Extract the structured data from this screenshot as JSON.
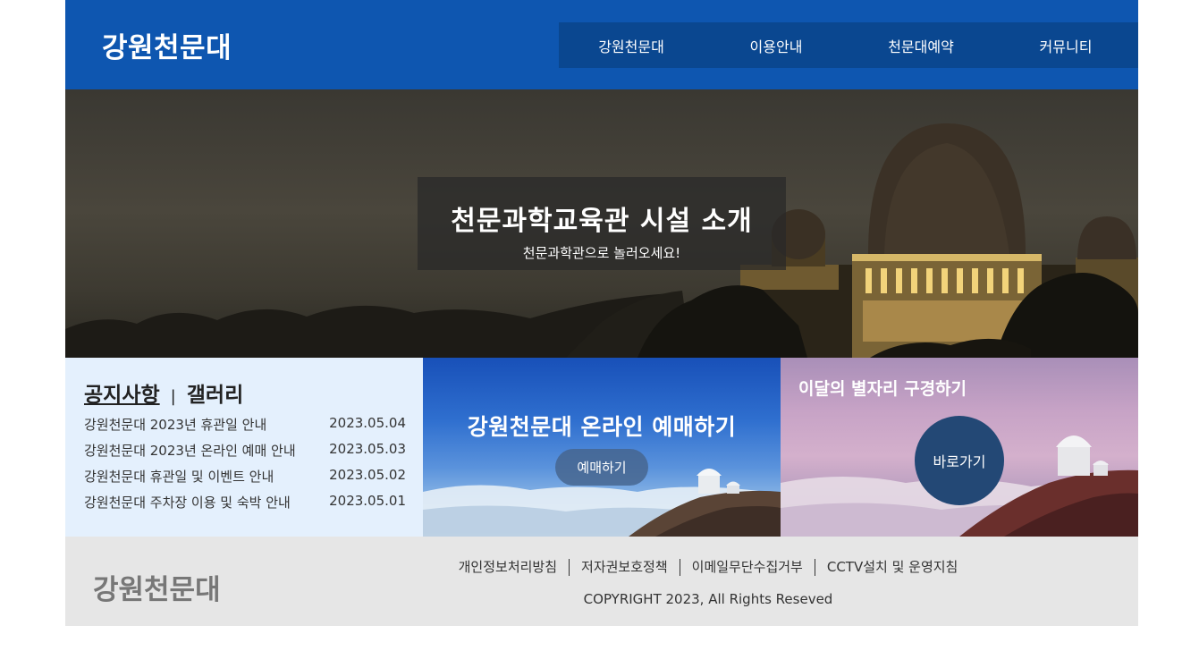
{
  "header": {
    "logo": "강원천문대",
    "nav": [
      "강원천문대",
      "이용안내",
      "천문대예약",
      "커뮤니티"
    ]
  },
  "hero": {
    "title": "천문과학교육관 시설 소개",
    "subtitle": "천문과학관으로 놀러오세요!"
  },
  "board": {
    "tab_notice": "공지사항",
    "separator": "|",
    "tab_gallery": "갤러리",
    "items": [
      {
        "title": "강원천문대 2023년 휴관일 안내",
        "date": "2023.05.04"
      },
      {
        "title": "강원천문대 2023년 온라인 예매 안내",
        "date": "2023.05.03"
      },
      {
        "title": "강원천문대 휴관일 및 이벤트 안내",
        "date": "2023.05.02"
      },
      {
        "title": "강원천문대 주차장 이용 및 숙박 안내",
        "date": "2023.05.01"
      }
    ]
  },
  "reserve": {
    "title": "강원천문대 온라인 예매하기",
    "button": "예매하기"
  },
  "constellation": {
    "title": "이달의 별자리 구경하기",
    "button": "바로가기"
  },
  "footer": {
    "logo": "강원천문대",
    "links": [
      "개인정보처리방침",
      "저자권보호정책",
      "이메일무단수집거부",
      "CCTV설치 및 운영지침"
    ],
    "copyright": "COPYRIGHT 2023, All Rights Reseved"
  },
  "colors": {
    "header_bg": "#0e56b0",
    "nav_bg": "#0a4790",
    "board_bg": "#e4f0fd",
    "footer_bg": "#e6e6e6",
    "button_dark_blue": "#234875"
  }
}
